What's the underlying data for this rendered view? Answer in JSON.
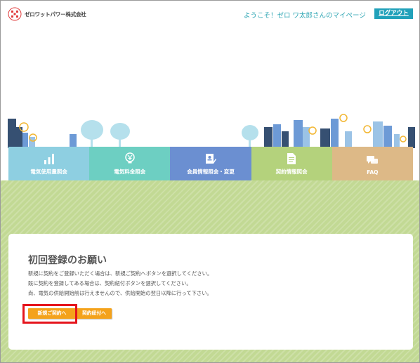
{
  "header": {
    "logo_text": "ゼロワットパワー株式会社",
    "welcome": "ようこそ！ゼロ ワ太郎さんのマイページ",
    "logout_label": "ログアウト"
  },
  "nav": {
    "items": [
      {
        "label": "電気使用量照会",
        "icon": "bar-chart-icon",
        "color": "#8ecfe1"
      },
      {
        "label": "電気料金照会",
        "icon": "lightbulb-yen-icon",
        "color": "#6dcfc2"
      },
      {
        "label": "会員情報照会・変更",
        "icon": "profile-edit-icon",
        "color": "#6b8fd1"
      },
      {
        "label": "契約情報照会",
        "icon": "document-icon",
        "color": "#b4d27c"
      },
      {
        "label": "FAQ",
        "icon": "chat-bubbles-icon",
        "color": "#ddb987"
      }
    ]
  },
  "notice": {
    "title": "初回登録のお願い",
    "lines": [
      "新規に契約をご登録いただく場合は、新規ご契約へボタンを選択してください。",
      "既に契約を登録してある場合は、契約紐付ボタンを選択してください。",
      "尚、電気の供給開始前は行えませんので、供給開始の翌日以降に行って下さい。"
    ],
    "new_contract_label": "新規ご契約へ",
    "link_contract_label": "契約紐付へ"
  },
  "colors": {
    "accent": "#21a1ba",
    "welcome_text": "#2fa6b4",
    "background_band": "#c2d994",
    "button": "#f4a21b",
    "highlight": "#e5141c"
  }
}
